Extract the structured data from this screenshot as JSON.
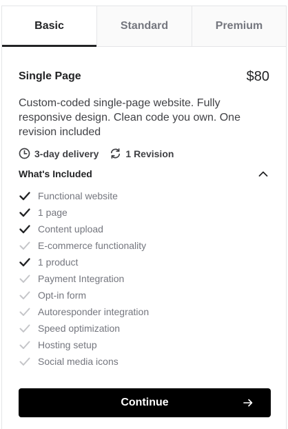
{
  "tabs": [
    {
      "label": "Basic",
      "active": true
    },
    {
      "label": "Standard",
      "active": false
    },
    {
      "label": "Premium",
      "active": false
    }
  ],
  "package": {
    "name": "Single Page",
    "price": "$80",
    "description": "Custom-coded single-page website. Fully responsive design. Clean code you own. One revision included",
    "delivery": "3-day delivery",
    "revisions": "1 Revision"
  },
  "included": {
    "title": "What's Included",
    "expanded": true,
    "features": [
      {
        "label": "Functional website",
        "included": true
      },
      {
        "label": "1 page",
        "included": true
      },
      {
        "label": "Content upload",
        "included": true
      },
      {
        "label": "E-commerce functionality",
        "included": false
      },
      {
        "label": "1 product",
        "included": true
      },
      {
        "label": "Payment Integration",
        "included": false
      },
      {
        "label": "Opt-in form",
        "included": false
      },
      {
        "label": "Autoresponder integration",
        "included": false
      },
      {
        "label": "Speed optimization",
        "included": false
      },
      {
        "label": "Hosting setup",
        "included": false
      },
      {
        "label": "Social media icons",
        "included": false
      }
    ]
  },
  "actions": {
    "continue_label": "Continue"
  },
  "colors": {
    "check_included": "#222325",
    "check_excluded": "#c5c6c9",
    "button_bg": "#000000"
  },
  "icons": {
    "delivery": "clock-icon",
    "revisions": "refresh-icon",
    "collapse": "chevron-up-icon",
    "included": "checkmark-icon",
    "continue": "arrow-right-icon"
  }
}
